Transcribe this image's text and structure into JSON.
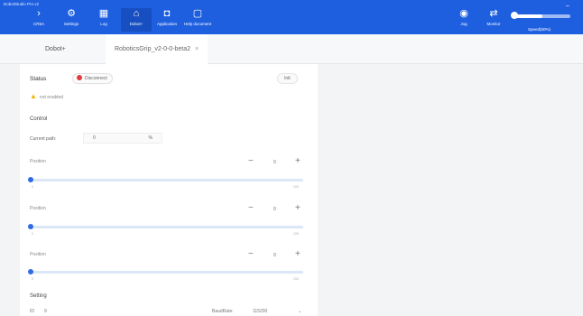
{
  "app": {
    "title": "DobotStudio Pro v2"
  },
  "nav": {
    "cr5a": {
      "label": "CR5A"
    },
    "settings": {
      "label": "Settings"
    },
    "log": {
      "label": "Log"
    },
    "dobot": {
      "label": "Dobot+"
    },
    "application": {
      "label": "Application"
    },
    "help": {
      "label": "Help document"
    },
    "jog": {
      "label": "Jog"
    },
    "monitor": {
      "label": "Monitor"
    }
  },
  "speed": {
    "label": "Speed(50%)",
    "value_percent": 50
  },
  "tabs": [
    {
      "label": "Dobot+"
    },
    {
      "label": "RoboticsGrip_v2-0-0-beta2",
      "close": "×"
    }
  ],
  "status": {
    "label": "Status",
    "state": "Disconnect",
    "init_button": "Init"
  },
  "warning": {
    "text": "not enabled"
  },
  "control": {
    "label": "Control",
    "current_path_label": "Current path:",
    "current_value": "0",
    "unit": "%"
  },
  "sliders": [
    {
      "label": "Position",
      "value": "0",
      "min": "0",
      "max": "100"
    },
    {
      "label": "Position",
      "value": "0",
      "min": "0",
      "max": "100"
    },
    {
      "label": "Position",
      "value": "0",
      "min": "0",
      "max": "100"
    }
  ],
  "setting": {
    "label": "Setting",
    "id_label": "ID",
    "id_value": "9",
    "baudrate_label": "BaudRate:",
    "baudrate_value": "115200"
  },
  "colors": {
    "topbar": "#1e5fe0",
    "accent": "#2f6be3",
    "status_red": "#e23b3b",
    "warning": "#f0b400"
  }
}
